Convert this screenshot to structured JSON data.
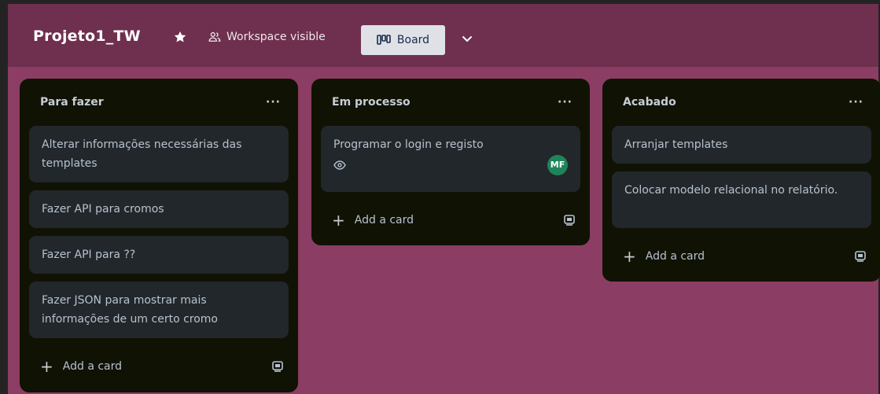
{
  "header": {
    "board_title": "Projeto1_TW",
    "star_icon": "star-icon",
    "visibility_label": "Workspace visible",
    "view_label": "Board",
    "colors": {
      "header_bg": "#6f2f4e",
      "board_bg": "#8c3d63"
    }
  },
  "lists": [
    {
      "title": "Para fazer",
      "menu": "···",
      "cards": [
        "Alterar informações necessárias das templates",
        "Fazer API para cromos",
        "Fazer API para ??",
        "Fazer JSON para mostrar mais informações de um certo cromo"
      ],
      "add_label": "Add a card"
    },
    {
      "title": "Em processo",
      "menu": "···",
      "cards": [
        {
          "text": "Programar o login e registo",
          "watch_icon": "eye-icon",
          "avatar": "MF"
        }
      ],
      "add_label": "Add a card"
    },
    {
      "title": "Acabado",
      "menu": "···",
      "cards": [
        "Arranjar templates",
        "Colocar modelo relacional no relatório."
      ],
      "add_label": "Add a card"
    }
  ]
}
